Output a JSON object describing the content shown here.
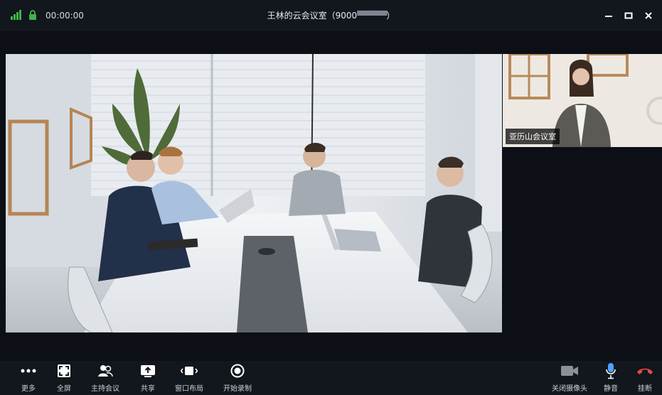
{
  "titlebar": {
    "timer": "00:00:00",
    "title_prefix": "王林的云会议室（9000",
    "title_redacted": "▀▀▀▀▀",
    "title_suffix": "）"
  },
  "main_video": {
    "description_icon": "meeting-room-video"
  },
  "pip": {
    "label": "亚历山会议室"
  },
  "toolbar": {
    "left": [
      {
        "label": "更多",
        "icon": "more-icon"
      },
      {
        "label": "全屏",
        "icon": "fullscreen-icon"
      },
      {
        "label": "主持会议",
        "icon": "host-icon"
      },
      {
        "label": "共享",
        "icon": "share-icon"
      },
      {
        "label": "窗口布局",
        "icon": "layout-icon"
      },
      {
        "label": "开始录制",
        "icon": "record-icon"
      }
    ],
    "right": [
      {
        "label": "关闭摄像头",
        "icon": "camera-icon"
      },
      {
        "label": "静音",
        "icon": "mic-icon"
      },
      {
        "label": "挂断",
        "icon": "hangup-icon"
      }
    ]
  },
  "colors": {
    "hangup": "#e5484d",
    "mic": "#4da3ff",
    "signal": "#3fb44a",
    "lock": "#3fb44a"
  }
}
